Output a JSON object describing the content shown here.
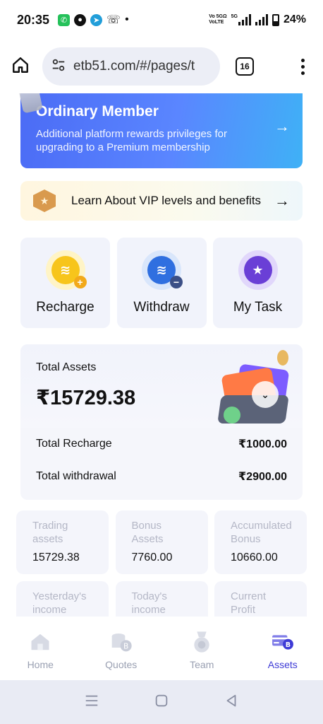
{
  "status_bar": {
    "time": "20:35",
    "dot": "•",
    "volte_line1": "Vo 5GΩ",
    "volte_line2": "VoLTE",
    "network": "5G",
    "battery": "24%",
    "icons": [
      "whatsapp-icon",
      "chat-icon",
      "telegram-icon",
      "missed-call-icon"
    ]
  },
  "browser": {
    "url": "etb51.com/#/pages/t",
    "tab_count": "16"
  },
  "member": {
    "title": "Ordinary Member",
    "description": "Additional platform rewards privileges for upgrading to a Premium membership",
    "arrow": "→"
  },
  "vip": {
    "text": "Learn About VIP levels and benefits",
    "arrow": "→"
  },
  "actions": [
    {
      "label": "Recharge",
      "icon": "recharge-coin-icon",
      "color": "#f7c51b"
    },
    {
      "label": "Withdraw",
      "icon": "withdraw-coin-icon",
      "color": "#2f6fe0"
    },
    {
      "label": "My Task",
      "icon": "task-star-icon",
      "color": "#6a3fd6"
    }
  ],
  "assets": {
    "label": "Total Assets",
    "value": "₹15729.38",
    "recharge_label": "Total Recharge",
    "recharge_value": "₹1000.00",
    "withdrawal_label": "Total withdrawal",
    "withdrawal_value": "₹2900.00"
  },
  "stats": [
    {
      "label": "Trading assets",
      "value": "15729.38"
    },
    {
      "label": "Bonus Assets",
      "value": "7760.00"
    },
    {
      "label": "Accumulated Bonus",
      "value": "10660.00"
    },
    {
      "label": "Yesterday's income",
      "value": ""
    },
    {
      "label": "Today's income",
      "value": ""
    },
    {
      "label": "Current Profit Margin",
      "value": ""
    }
  ],
  "nav": {
    "items": [
      {
        "label": "Home",
        "active": false
      },
      {
        "label": "Quotes",
        "active": false
      },
      {
        "label": "Team",
        "active": false
      },
      {
        "label": "Assets",
        "active": true
      }
    ],
    "active_color": "#3e3bd6",
    "inactive_color": "#9aa0b2"
  }
}
